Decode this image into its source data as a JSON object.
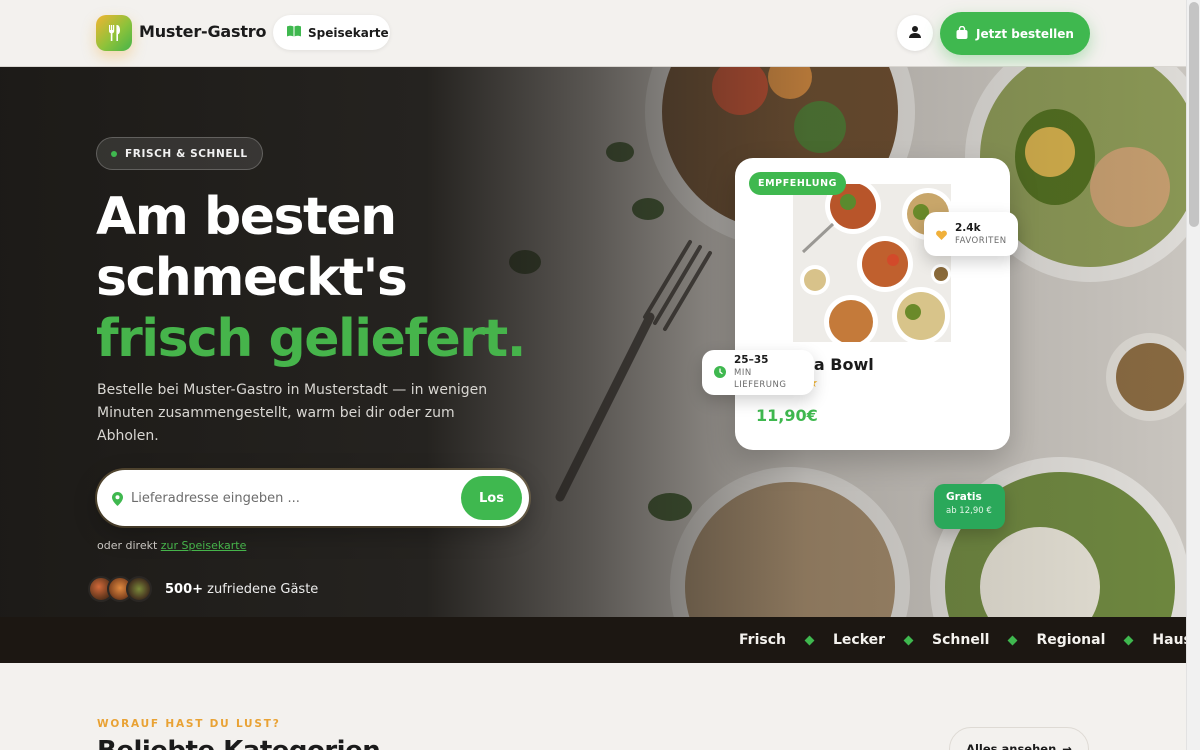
{
  "header": {
    "brand": "Muster-Gastro",
    "menu_label": "Speisekarte",
    "order_label": "Jetzt bestellen"
  },
  "hero": {
    "badge": "FRISCH & SCHNELL",
    "headline_line1": "Am besten",
    "headline_line2": "schmeckt's",
    "headline_line3": "frisch geliefert.",
    "subtitle": "Bestelle bei Muster-Gastro in Musterstadt — in wenigen Minuten zusammengestellt, warm bei dir oder zum Abholen.",
    "search_placeholder": "Lieferadresse eingeben ...",
    "search_button": "Los",
    "direct_prefix": "oder direkt",
    "direct_link": "zur Speisekarte",
    "guests_count": "500+",
    "guests_text": "zufriedene Gäste"
  },
  "card": {
    "badge": "EMPFEHLUNG",
    "dish": "Buddha Bowl",
    "stars": "★★★★★",
    "rating": 5,
    "price": "11,90€",
    "favorites_value": "2.4k",
    "favorites_label": "FAVORITEN",
    "time_value": "25–35",
    "time_label": "MIN LIEFERUNG",
    "free_value": "Gratis",
    "free_label": "ab 12,90 €"
  },
  "ticker": [
    "Frisch",
    "Lecker",
    "Schnell",
    "Regional",
    "Hausgema"
  ],
  "section": {
    "eyebrow": "WORAUF HAST DU LUST?",
    "title": "Beliebte Kategorien",
    "see_all": "Alles ansehen"
  },
  "colors": {
    "accent_green": "#3fb84f",
    "accent_orange": "#e9a234",
    "dark": "#1c1712"
  }
}
